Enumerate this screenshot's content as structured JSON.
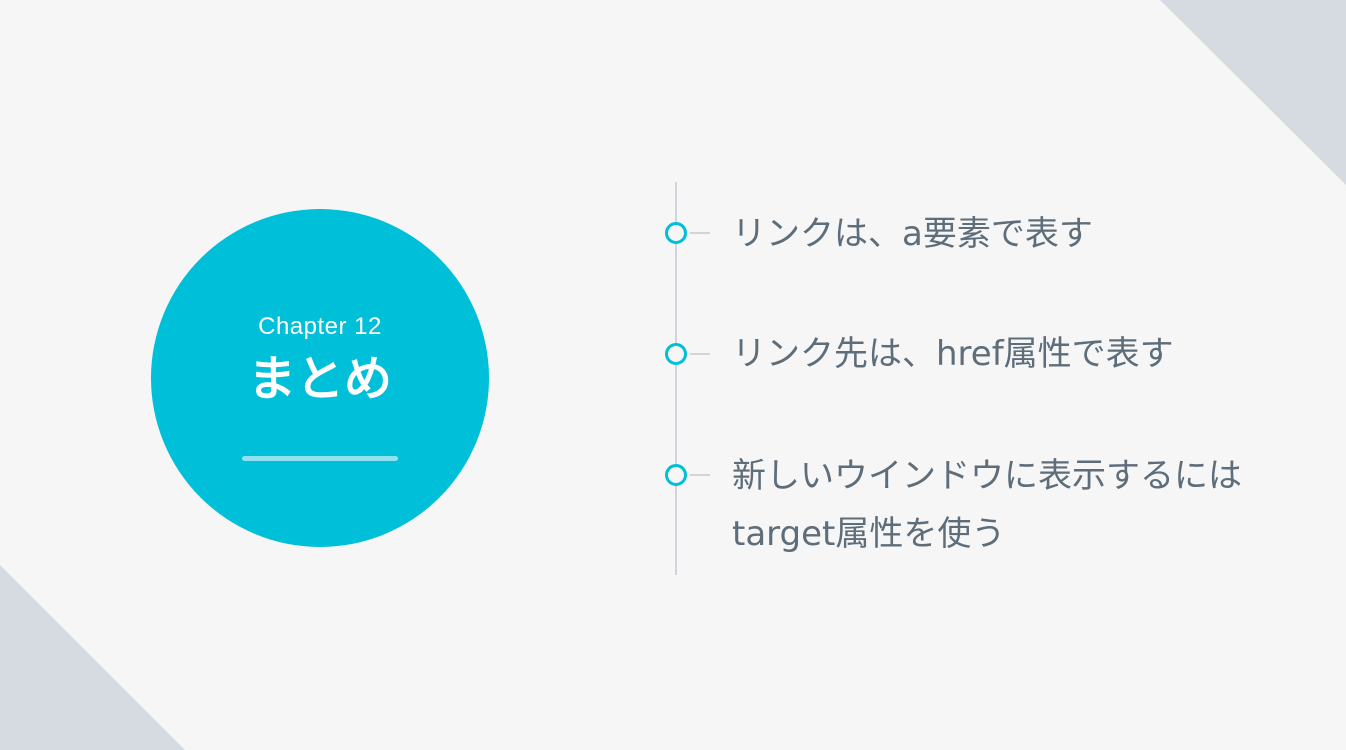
{
  "slide": {
    "chapter_label": "Chapter 12",
    "title": "まとめ",
    "items": [
      {
        "text": "リンクは、a要素で表す"
      },
      {
        "text": "リンク先は、href属性で表す"
      },
      {
        "text": "新しいウインドウに表示するには\ntarget属性を使う"
      }
    ]
  },
  "colors": {
    "accent": "#00bfd9",
    "background": "#f6f6f6",
    "text": "#5e6d7a",
    "line": "#cfd5da",
    "corner": "#d5dbe0"
  }
}
